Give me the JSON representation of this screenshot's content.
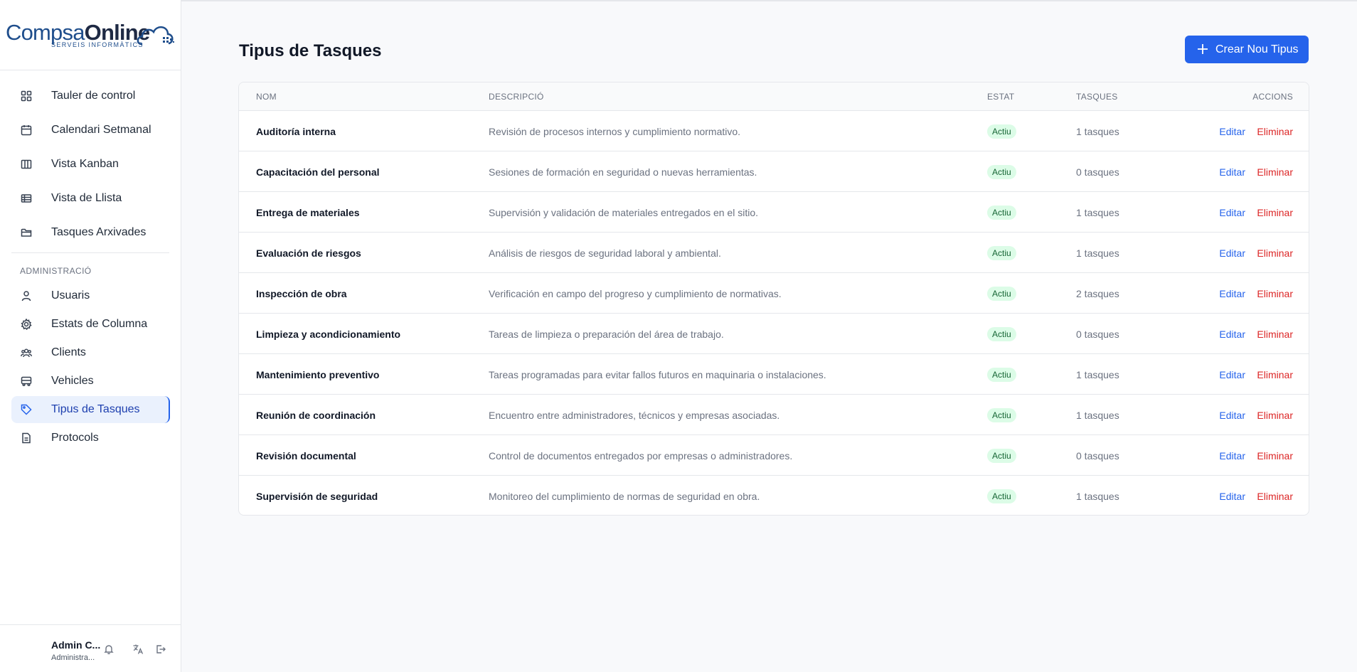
{
  "brand": {
    "part1": "Compsa",
    "part2": "Online",
    "tagline": "SERVEIS INFORMÀTICS"
  },
  "nav": {
    "items": [
      {
        "label": "Tauler de control",
        "icon": "dashboard-grid-icon"
      },
      {
        "label": "Calendari Setmanal",
        "icon": "calendar-icon"
      },
      {
        "label": "Vista Kanban",
        "icon": "kanban-icon"
      },
      {
        "label": "Vista de Llista",
        "icon": "list-table-icon"
      },
      {
        "label": "Tasques Arxivades",
        "icon": "folder-icon"
      }
    ],
    "section_label": "ADMINISTRACIÓ",
    "admin_items": [
      {
        "label": "Usuaris",
        "icon": "user-icon"
      },
      {
        "label": "Estats de Columna",
        "icon": "gear-icon"
      },
      {
        "label": "Clients",
        "icon": "users-icon"
      },
      {
        "label": "Vehicles",
        "icon": "bus-icon"
      },
      {
        "label": "Tipus de Tasques",
        "icon": "tag-icon",
        "active": true
      },
      {
        "label": "Protocols",
        "icon": "document-icon"
      }
    ]
  },
  "user": {
    "name": "Admin C...",
    "role": "Administra..."
  },
  "page": {
    "title": "Tipus de Tasques",
    "create_label": "Crear Nou Tipus"
  },
  "table": {
    "headers": {
      "name": "NOM",
      "description": "DESCRIPCIÓ",
      "status": "ESTAT",
      "tasks": "TASQUES",
      "actions": "ACCIONS"
    },
    "edit_label": "Editar",
    "delete_label": "Eliminar",
    "rows": [
      {
        "name": "Auditoría interna",
        "description": "Revisión de procesos internos y cumplimiento normativo.",
        "status": "Actiu",
        "tasks": "1 tasques"
      },
      {
        "name": "Capacitación del personal",
        "description": "Sesiones de formación en seguridad o nuevas herramientas.",
        "status": "Actiu",
        "tasks": "0 tasques"
      },
      {
        "name": "Entrega de materiales",
        "description": "Supervisión y validación de materiales entregados en el sitio.",
        "status": "Actiu",
        "tasks": "1 tasques"
      },
      {
        "name": "Evaluación de riesgos",
        "description": "Análisis de riesgos de seguridad laboral y ambiental.",
        "status": "Actiu",
        "tasks": "1 tasques"
      },
      {
        "name": "Inspección de obra",
        "description": "Verificación en campo del progreso y cumplimiento de normativas.",
        "status": "Actiu",
        "tasks": "2 tasques"
      },
      {
        "name": "Limpieza y acondicionamiento",
        "description": "Tareas de limpieza o preparación del área de trabajo.",
        "status": "Actiu",
        "tasks": "0 tasques"
      },
      {
        "name": "Mantenimiento preventivo",
        "description": "Tareas programadas para evitar fallos futuros en maquinaria o instalaciones.",
        "status": "Actiu",
        "tasks": "1 tasques"
      },
      {
        "name": "Reunión de coordinación",
        "description": "Encuentro entre administradores, técnicos y empresas asociadas.",
        "status": "Actiu",
        "tasks": "1 tasques"
      },
      {
        "name": "Revisión documental",
        "description": "Control de documentos entregados por empresas o administradores.",
        "status": "Actiu",
        "tasks": "0 tasques"
      },
      {
        "name": "Supervisión de seguridad",
        "description": "Monitoreo del cumplimiento de normas de seguridad en obra.",
        "status": "Actiu",
        "tasks": "1 tasques"
      }
    ]
  },
  "colors": {
    "accent": "#2563eb",
    "danger": "#dc2626",
    "success_bg": "#dcfce7",
    "success_text": "#166534",
    "brand": "#1f4e8c"
  }
}
